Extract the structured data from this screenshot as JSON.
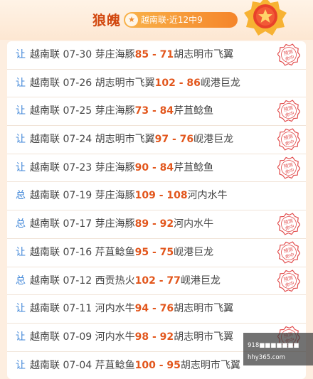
{
  "header": {
    "title": "狼魄",
    "badge_text": "越南联·近12中9",
    "badge_icon": "star-icon",
    "medal_icon": "star-medal-icon"
  },
  "rows": [
    {
      "tag": "让",
      "league": "越南联",
      "date": "07-30",
      "home": "芽庄海豚",
      "home_score": "85",
      "sep": " - ",
      "away_score": "71",
      "away": "胡志明市飞翼",
      "stamp": true
    },
    {
      "tag": "让",
      "league": "越南联",
      "date": "07-26",
      "home": "胡志明市飞翼",
      "home_score": "102",
      "sep": " - ",
      "away_score": "86",
      "away": "岘港巨龙",
      "stamp": false
    },
    {
      "tag": "让",
      "league": "越南联",
      "date": "07-25",
      "home": "芽庄海豚",
      "home_score": "73",
      "sep": " - ",
      "away_score": "84",
      "away": "芹苴鲶鱼",
      "stamp": true
    },
    {
      "tag": "让",
      "league": "越南联",
      "date": "07-24",
      "home": "胡志明市飞翼",
      "home_score": "97",
      "sep": " - ",
      "away_score": "76",
      "away": "岘港巨龙",
      "stamp": true
    },
    {
      "tag": "让",
      "league": "越南联",
      "date": "07-23",
      "home": "芽庄海豚",
      "home_score": "90",
      "sep": " - ",
      "away_score": "84",
      "away": "芹苴鲶鱼",
      "stamp": true
    },
    {
      "tag": "总",
      "league": "越南联",
      "date": "07-19",
      "home": "芽庄海豚",
      "home_score": "109",
      "sep": " - ",
      "away_score": "108",
      "away": "河内水牛",
      "stamp": false
    },
    {
      "tag": "总",
      "league": "越南联",
      "date": "07-17",
      "home": "芽庄海豚",
      "home_score": "89",
      "sep": " - ",
      "away_score": "92",
      "away": "河内水牛",
      "stamp": true
    },
    {
      "tag": "让",
      "league": "越南联",
      "date": "07-16",
      "home": "芹苴鲶鱼",
      "home_score": "95",
      "sep": " - ",
      "away_score": "75",
      "away": "岘港巨龙",
      "stamp": true
    },
    {
      "tag": "总",
      "league": "越南联",
      "date": "07-12",
      "home": "西贡热火",
      "home_score": "102",
      "sep": " - ",
      "away_score": "77",
      "away": "岘港巨龙",
      "stamp": true
    },
    {
      "tag": "让",
      "league": "越南联",
      "date": "07-11",
      "home": "河内水牛",
      "home_score": "94",
      "sep": " - ",
      "away_score": "76",
      "away": "胡志明市飞翼",
      "stamp": false
    },
    {
      "tag": "让",
      "league": "越南联",
      "date": "07-09",
      "home": "河内水牛",
      "home_score": "98",
      "sep": " - ",
      "away_score": "92",
      "away": "胡志明市飞翼",
      "stamp": true
    },
    {
      "tag": "让",
      "league": "越南联",
      "date": "07-04",
      "home": "芹苴鲶鱼",
      "home_score": "100",
      "sep": " - ",
      "away_score": "95",
      "away": "胡志明市飞翼",
      "stamp": false
    }
  ],
  "stamp": {
    "line1": "预测",
    "line2": "命中",
    "color": "#e24b4b"
  },
  "watermark": {
    "line1": "918■■■■■■■",
    "line2": "hhy365.com"
  },
  "colors": {
    "accent": "#d2480f",
    "score": "#e2561c",
    "tag": "#3f86d8"
  }
}
